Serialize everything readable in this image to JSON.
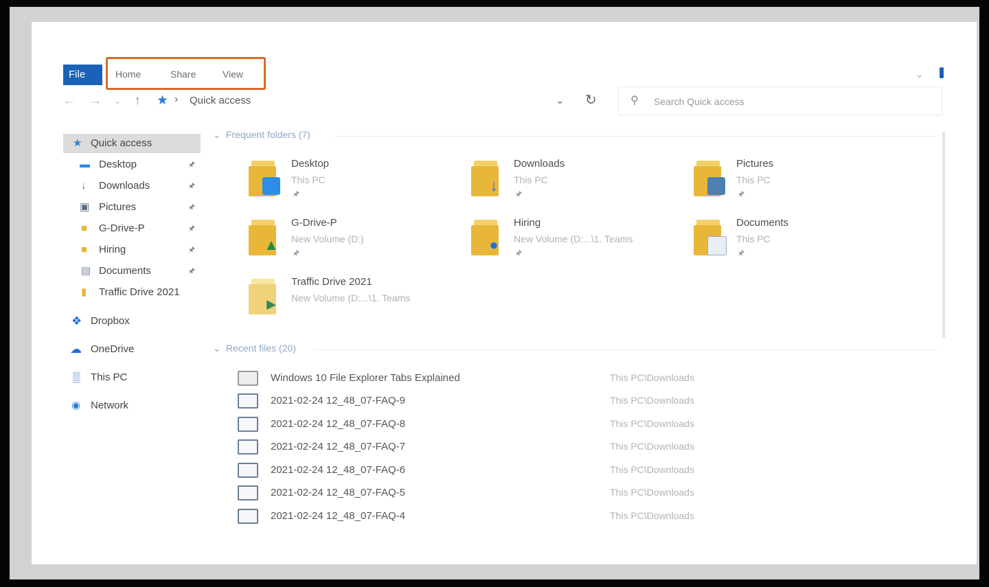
{
  "ribbon": {
    "file_label": "File",
    "tabs": [
      "Home",
      "Share",
      "View"
    ]
  },
  "address": {
    "path_label": "Quick access",
    "search_placeholder": "Search Quick access"
  },
  "sidebar": {
    "items": [
      {
        "label": "Quick access",
        "icon": "star-icon",
        "pinned": false
      },
      {
        "label": "Desktop",
        "icon": "desktop-icon",
        "pinned": true
      },
      {
        "label": "Downloads",
        "icon": "download-icon",
        "pinned": true
      },
      {
        "label": "Pictures",
        "icon": "pictures-icon",
        "pinned": true
      },
      {
        "label": "G-Drive-P",
        "icon": "drive-folder-icon",
        "pinned": true
      },
      {
        "label": "Hiring",
        "icon": "folder-icon",
        "pinned": true
      },
      {
        "label": "Documents",
        "icon": "documents-icon",
        "pinned": true
      },
      {
        "label": "Traffic Drive 2021",
        "icon": "folder-icon",
        "pinned": false
      },
      {
        "label": "Dropbox",
        "icon": "dropbox-icon",
        "pinned": false
      },
      {
        "label": "OneDrive",
        "icon": "cloud-icon",
        "pinned": false
      },
      {
        "label": "This PC",
        "icon": "pc-icon",
        "pinned": false
      },
      {
        "label": "Network",
        "icon": "network-icon",
        "pinned": false
      }
    ]
  },
  "frequent": {
    "header": "Frequent folders (7)",
    "folders": [
      {
        "name": "Desktop",
        "location": "This PC"
      },
      {
        "name": "Downloads",
        "location": "This PC"
      },
      {
        "name": "Pictures",
        "location": "This PC"
      },
      {
        "name": "G-Drive-P",
        "location": "New Volume (D:)"
      },
      {
        "name": "Hiring",
        "location": "New Volume (D:...\\1. Teams"
      },
      {
        "name": "Documents",
        "location": "This PC"
      },
      {
        "name": "Traffic Drive 2021",
        "location": "New Volume (D:...\\1. Teams"
      }
    ]
  },
  "recent": {
    "header": "Recent files (20)",
    "files": [
      {
        "name": "Windows 10 File Explorer Tabs Explained",
        "location": "This PC\\Downloads"
      },
      {
        "name": "2021-02-24 12_48_07-FAQ-9",
        "location": "This PC\\Downloads"
      },
      {
        "name": "2021-02-24 12_48_07-FAQ-8",
        "location": "This PC\\Downloads"
      },
      {
        "name": "2021-02-24 12_48_07-FAQ-7",
        "location": "This PC\\Downloads"
      },
      {
        "name": "2021-02-24 12_48_07-FAQ-6",
        "location": "This PC\\Downloads"
      },
      {
        "name": "2021-02-24 12_48_07-FAQ-5",
        "location": "This PC\\Downloads"
      },
      {
        "name": "2021-02-24 12_48_07-FAQ-4",
        "location": "This PC\\Downloads"
      }
    ]
  },
  "colors": {
    "accent": "#1a62b8",
    "highlight": "#d8692a",
    "folder": "#e8b73a"
  }
}
